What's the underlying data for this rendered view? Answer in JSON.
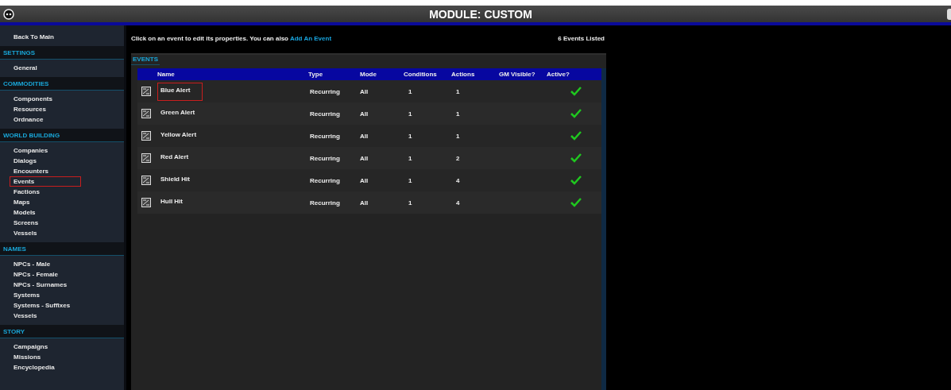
{
  "window": {
    "title": "MODULE: CUSTOM"
  },
  "sidebar": {
    "items": [
      {
        "kind": "link",
        "label": "Back To Main",
        "selected": false
      },
      {
        "kind": "section",
        "label": "SETTINGS"
      },
      {
        "kind": "link",
        "label": "General",
        "selected": false
      },
      {
        "kind": "section",
        "label": "COMMODITIES"
      },
      {
        "kind": "link",
        "label": "Components",
        "selected": false
      },
      {
        "kind": "link",
        "label": "Resources",
        "selected": false
      },
      {
        "kind": "link",
        "label": "Ordnance",
        "selected": false
      },
      {
        "kind": "section",
        "label": "WORLD BUILDING"
      },
      {
        "kind": "link",
        "label": "Companies",
        "selected": false
      },
      {
        "kind": "link",
        "label": "Dialogs",
        "selected": false
      },
      {
        "kind": "link",
        "label": "Encounters",
        "selected": false
      },
      {
        "kind": "link",
        "label": "Events",
        "selected": true
      },
      {
        "kind": "link",
        "label": "Factions",
        "selected": false
      },
      {
        "kind": "link",
        "label": "Maps",
        "selected": false
      },
      {
        "kind": "link",
        "label": "Models",
        "selected": false
      },
      {
        "kind": "link",
        "label": "Screens",
        "selected": false
      },
      {
        "kind": "link",
        "label": "Vessels",
        "selected": false
      },
      {
        "kind": "section",
        "label": "NAMES"
      },
      {
        "kind": "link",
        "label": "NPCs - Male",
        "selected": false
      },
      {
        "kind": "link",
        "label": "NPCs - Female",
        "selected": false
      },
      {
        "kind": "link",
        "label": "NPCs - Surnames",
        "selected": false
      },
      {
        "kind": "link",
        "label": "Systems",
        "selected": false
      },
      {
        "kind": "link",
        "label": "Systems - Suffixes",
        "selected": false
      },
      {
        "kind": "link",
        "label": "Vessels",
        "selected": false
      },
      {
        "kind": "section",
        "label": "STORY"
      },
      {
        "kind": "link",
        "label": "Campaigns",
        "selected": false
      },
      {
        "kind": "link",
        "label": "Missions",
        "selected": false
      },
      {
        "kind": "link",
        "label": "Encyclopedia",
        "selected": false
      }
    ]
  },
  "intro": {
    "text": "Click on an event to edit its properties. You can also",
    "link": "Add An Event",
    "count": "6 Events Listed"
  },
  "panel": {
    "title": "EVENTS"
  },
  "table": {
    "columns": [
      "Name",
      "Type",
      "Mode",
      "Conditions",
      "Actions",
      "GM Visible?",
      "Active?"
    ],
    "rows": [
      {
        "name": "Blue Alert",
        "type": "Recurring",
        "mode": "All",
        "conditions": "1",
        "actions": "1",
        "gm_visible": false,
        "active": true,
        "selected": true
      },
      {
        "name": "Green Alert",
        "type": "Recurring",
        "mode": "All",
        "conditions": "1",
        "actions": "1",
        "gm_visible": false,
        "active": true,
        "selected": false
      },
      {
        "name": "Yellow Alert",
        "type": "Recurring",
        "mode": "All",
        "conditions": "1",
        "actions": "1",
        "gm_visible": false,
        "active": true,
        "selected": false
      },
      {
        "name": "Red Alert",
        "type": "Recurring",
        "mode": "All",
        "conditions": "1",
        "actions": "2",
        "gm_visible": false,
        "active": true,
        "selected": false
      },
      {
        "name": "Shield Hit",
        "type": "Recurring",
        "mode": "All",
        "conditions": "1",
        "actions": "4",
        "gm_visible": false,
        "active": true,
        "selected": false
      },
      {
        "name": "Hull Hit",
        "type": "Recurring",
        "mode": "All",
        "conditions": "1",
        "actions": "4",
        "gm_visible": false,
        "active": true,
        "selected": false
      }
    ]
  }
}
